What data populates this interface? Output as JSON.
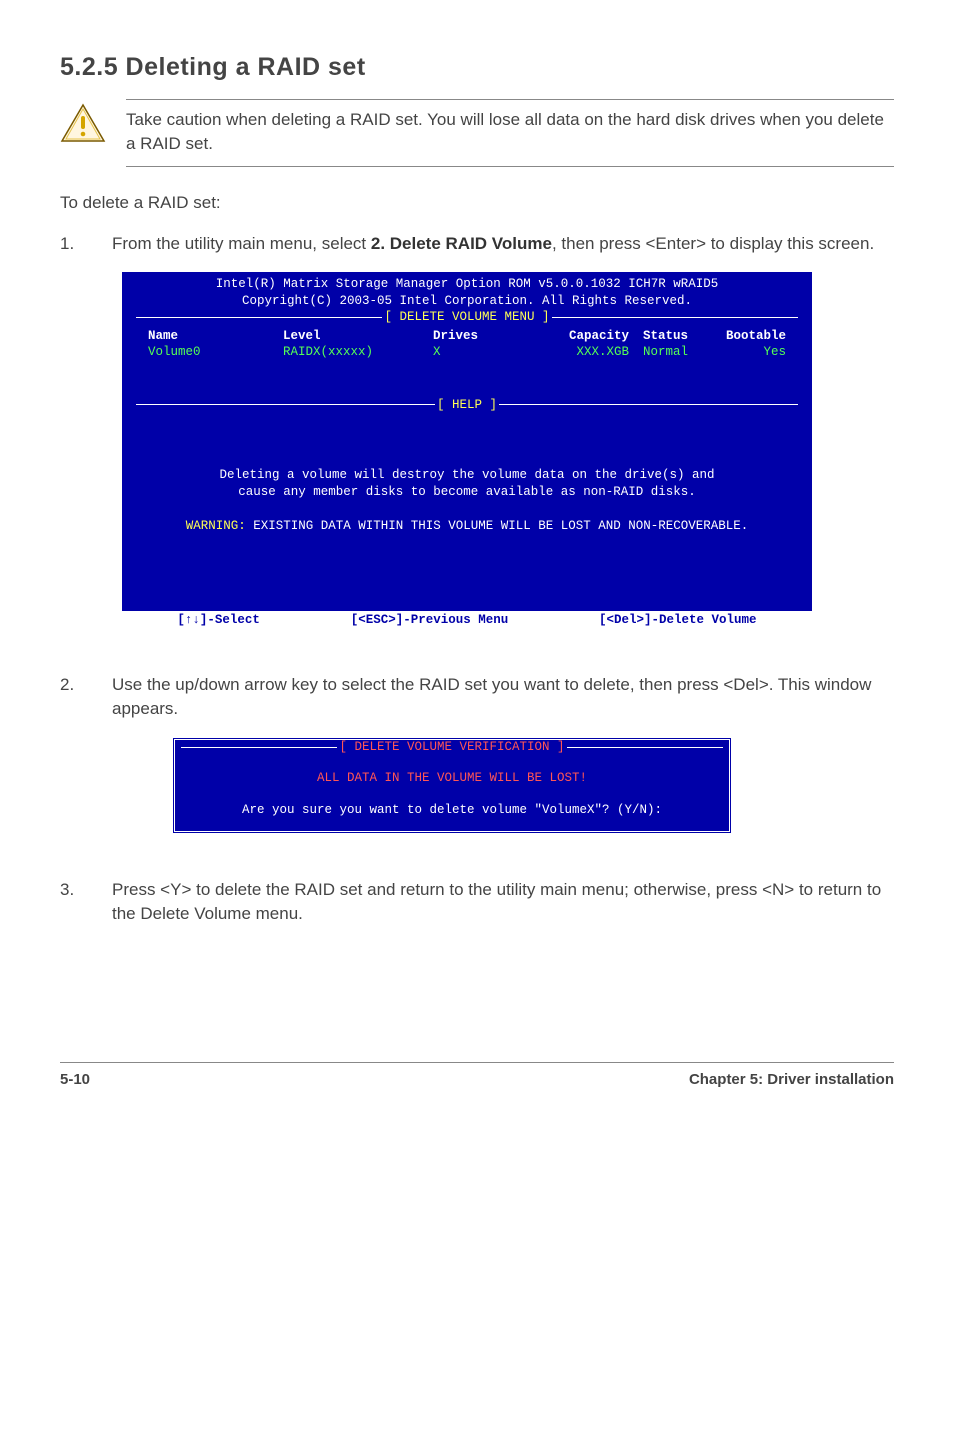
{
  "heading": "5.2.5   Deleting a RAID set",
  "caution": "Take caution when deleting a RAID set. You will lose all data on the hard disk drives when you delete a RAID set.",
  "intro": "To delete a RAID set:",
  "steps": {
    "s1": {
      "num": "1.",
      "text_before": "From the utility main menu, select ",
      "bold": "2. Delete RAID Volume",
      "text_after": ", then press <Enter> to display this screen."
    },
    "s2": {
      "num": "2.",
      "text": "Use the up/down arrow key to select the RAID set you want to delete, then press <Del>. This window appears."
    },
    "s3": {
      "num": "3.",
      "text": "Press <Y> to delete the RAID set and return to the utility main menu; otherwise, press <N> to return to the Delete Volume menu."
    }
  },
  "bios1": {
    "header1": "Intel(R) Matrix Storage Manager Option ROM v5.0.0.1032 ICH7R wRAID5",
    "header2": "Copyright(C) 2003-05 Intel Corporation. All Rights Reserved.",
    "menu_label": "[ DELETE VOLUME MENU ]",
    "cols": {
      "name": "Name",
      "level": "Level",
      "drives": "Drives",
      "capacity": "Capacity",
      "status": "Status",
      "bootable": "Bootable"
    },
    "row": {
      "name": "Volume0",
      "level": "RAIDX(xxxxx)",
      "drives": "X",
      "capacity": "XXX.XGB",
      "status": "Normal",
      "bootable": "Yes"
    },
    "help_label": "[ HELP ]",
    "help_msg1": "Deleting a volume will destroy the volume data on the drive(s) and",
    "help_msg2": "cause any member disks to become available as non-RAID disks.",
    "warn_label": "WARNING:",
    "warn_text": " EXISTING DATA WITHIN THIS VOLUME WILL BE LOST AND NON-RECOVERABLE.",
    "footer": {
      "select": "[↑↓]-Select",
      "prev": "[<ESC>]-Previous Menu",
      "del": "[<Del>]-Delete Volume"
    }
  },
  "bios2": {
    "title": "[ DELETE VOLUME VERIFICATION ]",
    "red_line": "ALL DATA IN THE VOLUME WILL BE LOST!",
    "question": "Are you sure you want to delete volume \"VolumeX\"? (Y/N):"
  },
  "footer": {
    "left": "5-10",
    "right": "Chapter 5: Driver installation"
  }
}
